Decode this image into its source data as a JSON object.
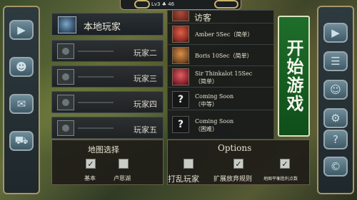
{
  "topbar": {
    "status": "Lv3 ♣ 46"
  },
  "players": {
    "local_label": "本地玩家",
    "slots": [
      "玩家二",
      "玩家三",
      "玩家四",
      "玩家五"
    ]
  },
  "ai_list": {
    "header": "访客",
    "entries": [
      {
        "name": "Amber 5Sec（简单）",
        "icon": "amber-portrait-icon"
      },
      {
        "name": "Boris 10Sec（简单）",
        "icon": "boris-portrait-icon"
      },
      {
        "name": "Sir Thinkalot 15Sec\n（简单）",
        "icon": "sir-thinkalot-portrait-icon"
      },
      {
        "name": "Coming Soon\n（中等）",
        "icon": "question-mark-icon"
      },
      {
        "name": "Coming Soon\n（困难）",
        "icon": "question-mark-icon"
      }
    ]
  },
  "start_button": "开始游戏",
  "map_select": {
    "title": "地图选择",
    "options": [
      {
        "label": "基本",
        "checked": true
      },
      {
        "label": "卢恩湖",
        "checked": false
      }
    ]
  },
  "options": {
    "title": "Options",
    "items": [
      {
        "label": "打乱玩家",
        "checked": false
      },
      {
        "label": "扩展放弃规则",
        "checked": true
      },
      {
        "label": "地图平衡胜利点数",
        "checked": true
      }
    ]
  },
  "left_icons": [
    "play-icon",
    "profile-icon",
    "chat-icon",
    "cart-icon"
  ],
  "right_icons": [
    "video-icon",
    "list-icon",
    "people-icon",
    "settings-icon",
    "question-icon",
    "copyright-icon"
  ]
}
